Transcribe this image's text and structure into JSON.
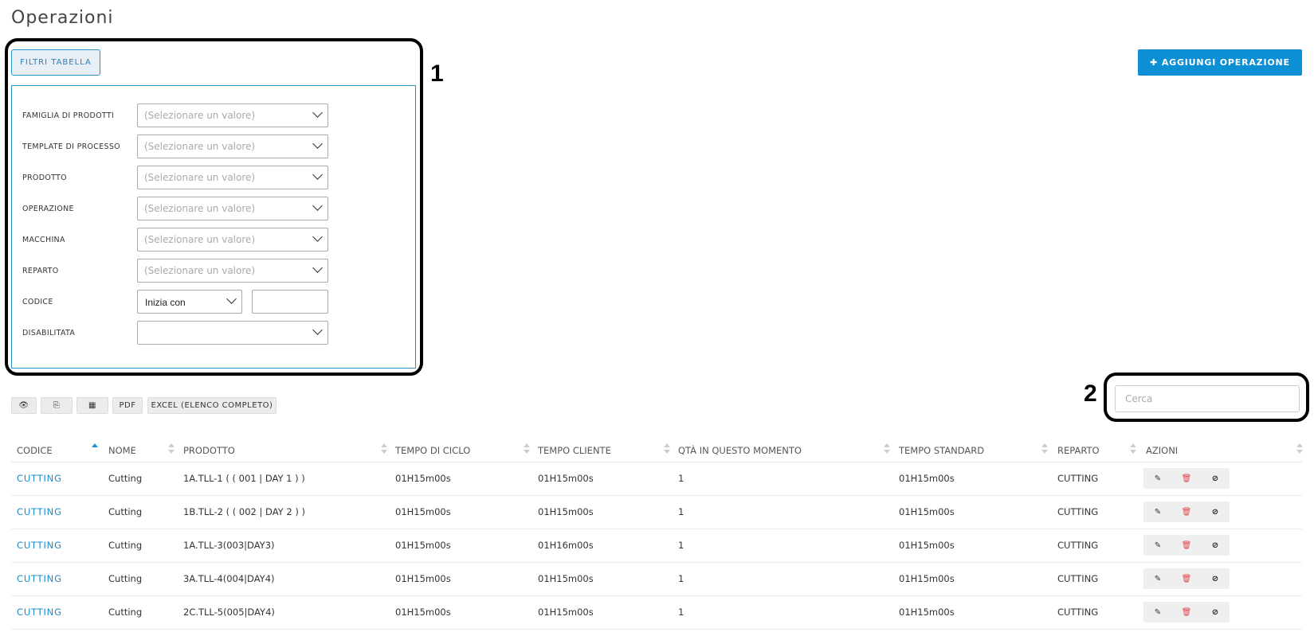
{
  "page": {
    "title": "Operazioni"
  },
  "callouts": {
    "one": "1",
    "two": "2"
  },
  "filters": {
    "toggle_label": "FILTRI TABELLA",
    "placeholder": "(Selezionare un valore)",
    "rows": [
      {
        "label": "FAMIGLIA DI PRODOTTI"
      },
      {
        "label": "TEMPLATE DI PROCESSO"
      },
      {
        "label": "PRODOTTO"
      },
      {
        "label": "OPERAZIONE"
      },
      {
        "label": "MACCHINA"
      },
      {
        "label": "REPARTO"
      },
      {
        "label": "CODICE",
        "select_value": "Inizia con"
      },
      {
        "label": "DISABILITATA"
      }
    ]
  },
  "add_button": {
    "label": "✚ AGGIUNGI OPERAZIONE"
  },
  "toolbar": {
    "eye_icon": "👁",
    "copy_icon": "⎘",
    "grid_icon": "▦",
    "pdf_label": "PDF",
    "excel_label": "EXCEL (ELENCO COMPLETO)"
  },
  "search": {
    "placeholder": "Cerca"
  },
  "table": {
    "columns": [
      "CODICE",
      "NOME",
      "PRODOTTO",
      "TEMPO DI CICLO",
      "TEMPO CLIENTE",
      "QTÀ IN QUESTO MOMENTO",
      "TEMPO STANDARD",
      "REPARTO",
      "AZIONI"
    ],
    "rows": [
      [
        "CUTTING",
        "Cutting",
        "1A.TLL-1 ( ( 001 | DAY 1 ) )",
        "01H15m00s",
        "01H15m00s",
        "1",
        "01H15m00s",
        "CUTTING"
      ],
      [
        "CUTTING",
        "Cutting",
        "1B.TLL-2 ( ( 002 | DAY 2 ) )",
        "01H15m00s",
        "01H15m00s",
        "1",
        "01H15m00s",
        "CUTTING"
      ],
      [
        "CUTTING",
        "Cutting",
        "1A.TLL-3(003|DAY3)",
        "01H15m00s",
        "01H16m00s",
        "1",
        "01H15m00s",
        "CUTTING"
      ],
      [
        "CUTTING",
        "Cutting",
        "3A.TLL-4(004|DAY4)",
        "01H15m00s",
        "01H15m00s",
        "1",
        "01H15m00s",
        "CUTTING"
      ],
      [
        "CUTTING",
        "Cutting",
        "2C.TLL-5(005|DAY4)",
        "01H15m00s",
        "01H15m00s",
        "1",
        "01H15m00s",
        "CUTTING"
      ]
    ],
    "action_icons": {
      "edit": "✎",
      "delete": "🗑",
      "disable": "⊘"
    }
  }
}
